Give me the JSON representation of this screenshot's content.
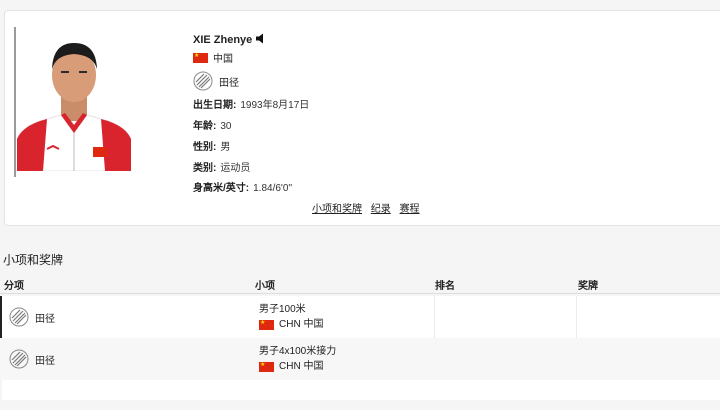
{
  "athlete": {
    "name": "XIE Zhenye",
    "country": "中国",
    "sport": "田径",
    "fields": [
      {
        "label": "出生日期:",
        "value": "1993年8月17日"
      },
      {
        "label": "年龄:",
        "value": "30"
      },
      {
        "label": "性别:",
        "value": "男"
      },
      {
        "label": "类别:",
        "value": "运动员"
      },
      {
        "label": "身高米/英寸:",
        "value": "1.84/6'0''"
      }
    ]
  },
  "links": [
    "小项和奖牌",
    "纪录",
    "赛程"
  ],
  "section_title": "小项和奖牌",
  "table": {
    "headers": [
      "分项",
      "小项",
      "排名",
      "奖牌"
    ],
    "rows": [
      {
        "sport": "田径",
        "event": "男子100米",
        "noc": "CHN 中国",
        "rank": "",
        "medal": ""
      },
      {
        "sport": "田径",
        "event": "男子4x100米接力",
        "noc": "CHN 中国",
        "rank": "",
        "medal": ""
      }
    ]
  },
  "colors": {
    "flag_red": "#de2910",
    "flag_star": "#ffde00",
    "jacket_red": "#d9232d"
  }
}
